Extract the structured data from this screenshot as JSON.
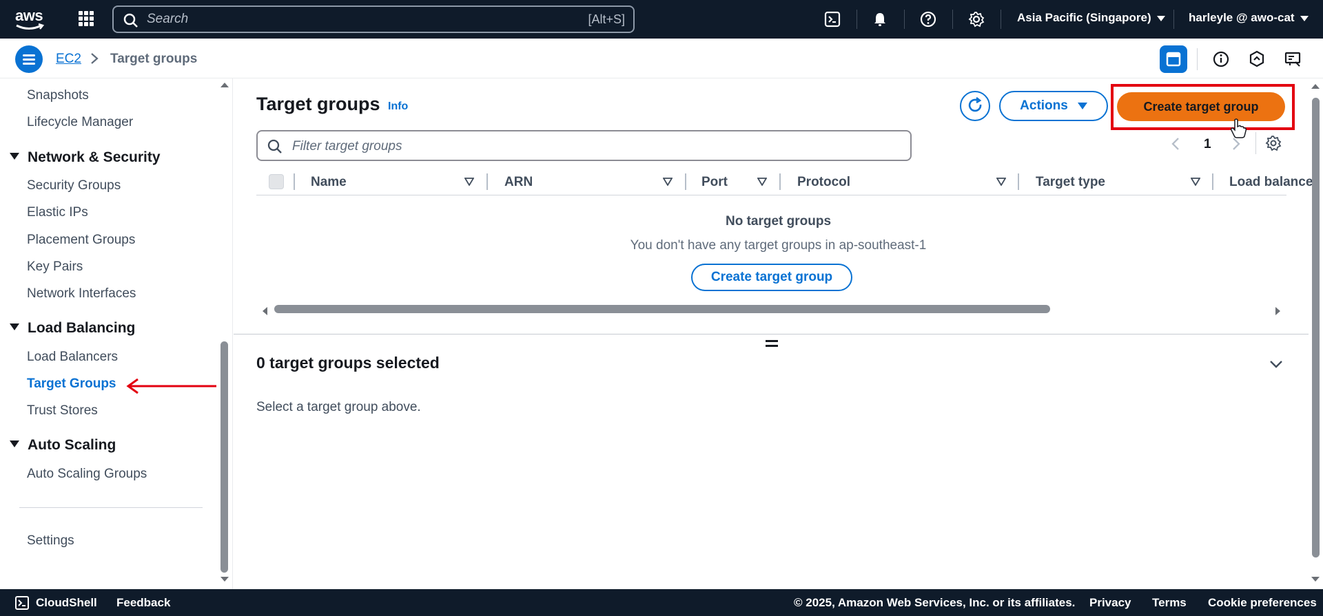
{
  "topnav": {
    "logo_text": "aws",
    "search_placeholder": "Search",
    "search_shortcut": "[Alt+S]",
    "region": "Asia Pacific (Singapore)",
    "account": "harleyle @ awo-cat"
  },
  "breadcrumb": {
    "root": "EC2",
    "current": "Target groups"
  },
  "sidebar": {
    "items_top": [
      "Snapshots",
      "Lifecycle Manager"
    ],
    "network_header": "Network & Security",
    "network_items": [
      "Security Groups",
      "Elastic IPs",
      "Placement Groups",
      "Key Pairs",
      "Network Interfaces"
    ],
    "lb_header": "Load Balancing",
    "lb_items": [
      "Load Balancers",
      "Target Groups",
      "Trust Stores"
    ],
    "as_header": "Auto Scaling",
    "as_items": [
      "Auto Scaling Groups"
    ],
    "settings": "Settings",
    "active_item": "Target Groups"
  },
  "main": {
    "title": "Target groups",
    "info": "Info",
    "actions_label": "Actions",
    "create_label": "Create target group",
    "filter_placeholder": "Filter target groups",
    "page_number": "1",
    "columns": [
      "Name",
      "ARN",
      "Port",
      "Protocol",
      "Target type",
      "Load balance"
    ],
    "empty_title": "No target groups",
    "empty_subtitle": "You don't have any target groups in ap-southeast-1",
    "empty_button": "Create target group",
    "detail_title": "0 target groups selected",
    "detail_text": "Select a target group above."
  },
  "footer": {
    "cloudshell": "CloudShell",
    "feedback": "Feedback",
    "copyright": "© 2025, Amazon Web Services, Inc. or its affiliates.",
    "privacy": "Privacy",
    "terms": "Terms",
    "cookies": "Cookie preferences"
  },
  "colors": {
    "nav_bg": "#0f1b2a",
    "accent": "#0972d3",
    "primary_button": "#ec7211",
    "highlight": "#e3000f"
  }
}
